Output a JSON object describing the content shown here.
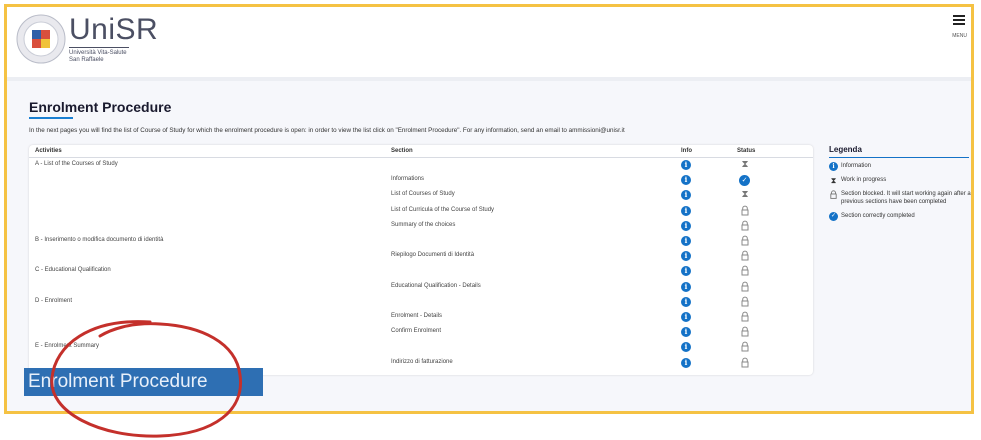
{
  "header": {
    "logo_name": "UniSR",
    "logo_sub_1": "Università Vita-Salute",
    "logo_sub_2": "San Raffaele",
    "menu_label": "MENU"
  },
  "page": {
    "title": "Enrolment Procedure",
    "intro": "In the next pages you will find the list of Course of Study for which the enrolment procedure is open: in order to view the list click on \"Enrolment Procedure\". For any information, send an email to ammissioni@unisr.it"
  },
  "table": {
    "headers": {
      "activities": "Activities",
      "section": "Section",
      "info": "Info",
      "status": "Status"
    },
    "rows": [
      {
        "activity": "A - List of the Courses of Study",
        "section": "",
        "status": "pending"
      },
      {
        "activity": "",
        "section": "Informations",
        "status": "done"
      },
      {
        "activity": "",
        "section": "List of Courses of Study",
        "status": "pending"
      },
      {
        "activity": "",
        "section": "List of Curricula of the Course of Study",
        "status": "locked"
      },
      {
        "activity": "",
        "section": "Summary of the choices",
        "status": "locked"
      },
      {
        "activity": "B - Inserimento o modifica documento di identità",
        "section": "",
        "status": "locked"
      },
      {
        "activity": "",
        "section": "Riepilogo Documenti di Identità",
        "status": "locked"
      },
      {
        "activity": "C - Educational Qualification",
        "section": "",
        "status": "locked"
      },
      {
        "activity": "",
        "section": "Educational Qualification - Details",
        "status": "locked"
      },
      {
        "activity": "D - Enrolment",
        "section": "",
        "status": "locked"
      },
      {
        "activity": "",
        "section": "Enrolment - Details",
        "status": "locked"
      },
      {
        "activity": "",
        "section": "Confirm Enrolment",
        "status": "locked"
      },
      {
        "activity": "E - Enrolment Summary",
        "section": "",
        "status": "locked"
      },
      {
        "activity": "",
        "section": "Indirizzo di fatturazione",
        "status": "locked"
      }
    ]
  },
  "legend": {
    "title": "Legenda",
    "items": [
      {
        "icon": "info-icon",
        "text": "Information"
      },
      {
        "icon": "hourglass-icon",
        "text": "Work in progress"
      },
      {
        "icon": "lock-icon",
        "text": "Section blocked. It will start working again after all previous sections have been completed"
      },
      {
        "icon": "check-icon",
        "text": "Section correctly completed"
      }
    ]
  },
  "overlay": {
    "highlight_text": "Enrolment Procedure"
  },
  "colors": {
    "accent": "#1472c7",
    "frame": "#f5c243",
    "highlight": "#2e6fb3",
    "circle": "#c4302b"
  }
}
